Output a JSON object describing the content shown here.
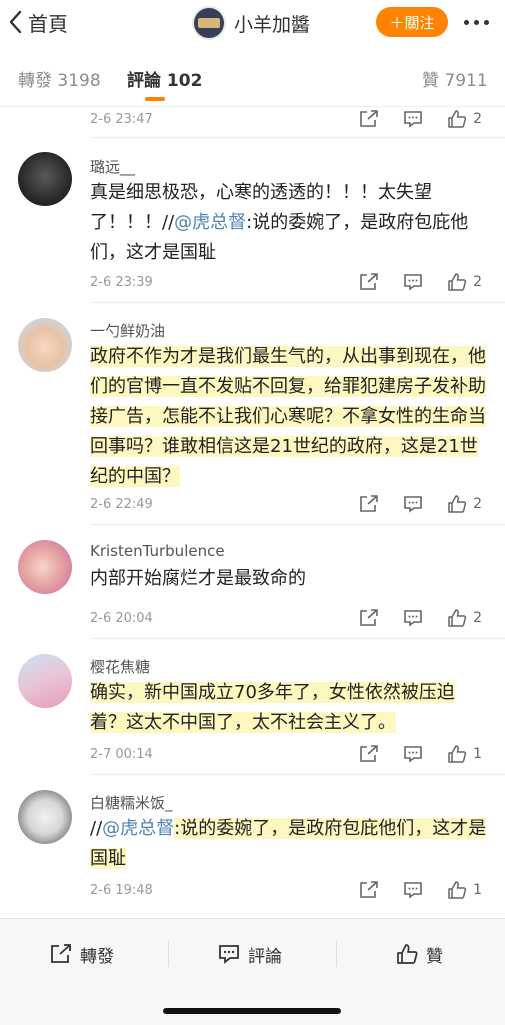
{
  "header": {
    "back_label": "首頁",
    "title": "小羊加醬",
    "follow_label": "＋關注",
    "follow_color": "#ff8200"
  },
  "tabs": [
    {
      "label": "轉發 3198"
    },
    {
      "label": "評論 102"
    },
    {
      "label": "贊 7911"
    }
  ],
  "prev_comment_meta": {
    "time": "2-6 23:47",
    "likes": "2"
  },
  "comments": [
    {
      "author": "璐远__",
      "text_main": "真是细思极恐，心寒的透透的！！！太失望了！！！//",
      "mention": "@虎总督",
      "text_after": ":说的委婉了，是政府包庇他们，这才是国耻",
      "time": "2-6 23:39",
      "likes": "2"
    },
    {
      "author": "一勺鲜奶油",
      "text": "政府不作为才是我们最生气的，从出事到现在，他们的官博一直不发贴不回复，给罪犯建房子发补助接广告，怎能不让我们心寒呢？不拿女性的生命当回事吗？谁敢相信这是21世纪的政府，这是21世纪的中国？",
      "time": "2-6 22:49",
      "likes": "2"
    },
    {
      "author": "KristenTurbulence",
      "text": "内部开始腐烂才是最致命的",
      "time": "2-6 20:04",
      "likes": "2"
    },
    {
      "author": "樱花焦糖",
      "text": "确实，新中国成立70多年了，女性依然被压迫着？这太不中国了，太不社会主义了。",
      "time": "2-7 00:14",
      "likes": "1"
    },
    {
      "author": "白糖糯米饭_",
      "text_prefix": "//",
      "mention": "@虎总督",
      "text_after": ":说的委婉了，是政府包庇他们，这才是国耻",
      "time": "2-6 19:48",
      "likes": "1"
    }
  ],
  "bottom_bar": {
    "repost_label": "轉發",
    "comment_label": "評論",
    "like_label": "贊"
  },
  "colors": {
    "accent": "#ff8200",
    "mention": "#5083b5",
    "highlight": "#fff08c"
  }
}
